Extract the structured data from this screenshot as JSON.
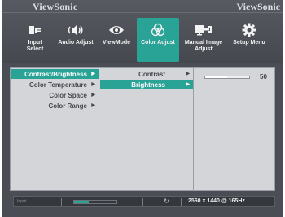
{
  "brand": "ViewSonic",
  "brand_right": "ViewSonic",
  "tabs": [
    {
      "label": "Input\nSelect",
      "icon": "input-icon"
    },
    {
      "label": "Audio Adjust",
      "icon": "speaker-icon"
    },
    {
      "label": "ViewMode",
      "icon": "eye-icon"
    },
    {
      "label": "Color Adjust",
      "icon": "color-circles-icon",
      "active": true
    },
    {
      "label": "Manual Image\nAdjust",
      "icon": "monitor-wrench-icon"
    },
    {
      "label": "Setup Menu",
      "icon": "gear-icon"
    }
  ],
  "menu_col1": [
    {
      "label": "Contrast/Brightness",
      "active": true
    },
    {
      "label": "Color Temperature"
    },
    {
      "label": "Color Space"
    },
    {
      "label": "Color Range"
    }
  ],
  "menu_col2": [
    {
      "label": "Contrast"
    },
    {
      "label": "Brightness",
      "active": true
    }
  ],
  "brightness": {
    "value": "50",
    "level": 50
  },
  "status": {
    "resolution": "2560 x 1440 @ 165Hz",
    "input_label": "Input"
  },
  "colors": {
    "accent": "#2aa397",
    "panel": "#d3d5d9",
    "osd_bg": "#4a4d53"
  }
}
